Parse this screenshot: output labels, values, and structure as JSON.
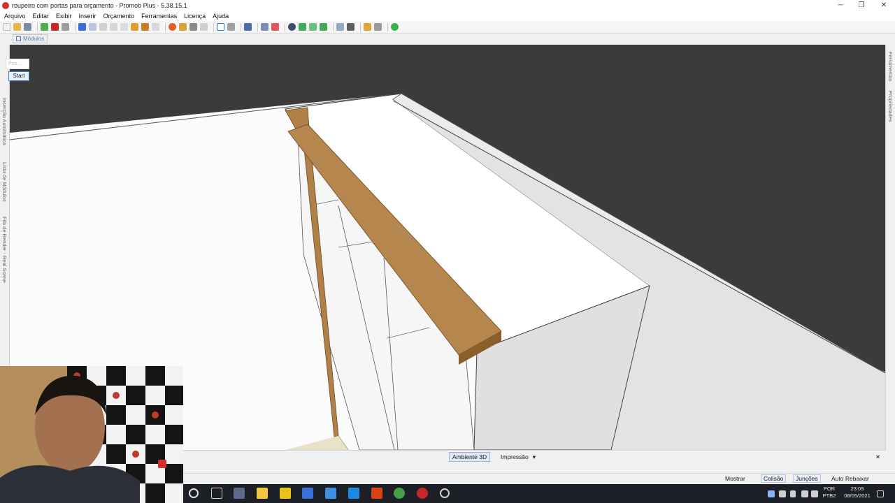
{
  "window": {
    "title": "roupeiro com portas para orçamento - Promob Plus - 5.38.15.1",
    "minimize": "─",
    "maximize": "❐",
    "close": "✕"
  },
  "menu": [
    "Arquivo",
    "Editar",
    "Exibir",
    "Inserir",
    "Orçamento",
    "Ferramentas",
    "Licença",
    "Ajuda"
  ],
  "module_tab": "Módulos",
  "left_panel": {
    "tabs": [
      "Inserção Automática",
      "Lista de Módulos",
      "Fila de Render - Real Scene"
    ]
  },
  "right_panel": {
    "tabs": [
      "Ferramentas",
      "Propriedades"
    ]
  },
  "viewport": {
    "start_button": "Start",
    "pos_placeholder": "Pos..."
  },
  "bottom_tabs": {
    "ambiente": "Ambiente 3D",
    "impressao": "Impressão",
    "dropdown": "▾",
    "close": "✕"
  },
  "status": {
    "mostrar": "Mostrar",
    "colisao": "Colisão",
    "juncoes": "Junções",
    "auto_rebaixar": "Auto Rebaixar"
  },
  "taskbar": {
    "lang_line1": "POR",
    "lang_line2": "PTB2",
    "time": "23:09",
    "date": "08/05/2021"
  },
  "colors": {
    "background_top": "#3c3c3c",
    "wood": "#b0824a",
    "cabinet": "#ffffff",
    "taskbar": "#1c1f26"
  }
}
